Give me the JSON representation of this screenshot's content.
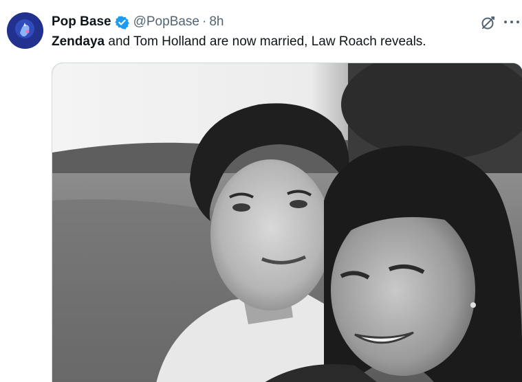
{
  "tweet": {
    "display_name": "Pop Base",
    "handle": "@PopBase",
    "separator": "·",
    "time": "8h",
    "text_mention": "Zendaya",
    "text_rest": " and Tom Holland are now married, Law Roach reveals.",
    "verified_color": "#1d9bf0",
    "icons": {
      "verified": "verified-badge-icon",
      "grok": "grok-icon",
      "more": "more-options-icon"
    }
  }
}
